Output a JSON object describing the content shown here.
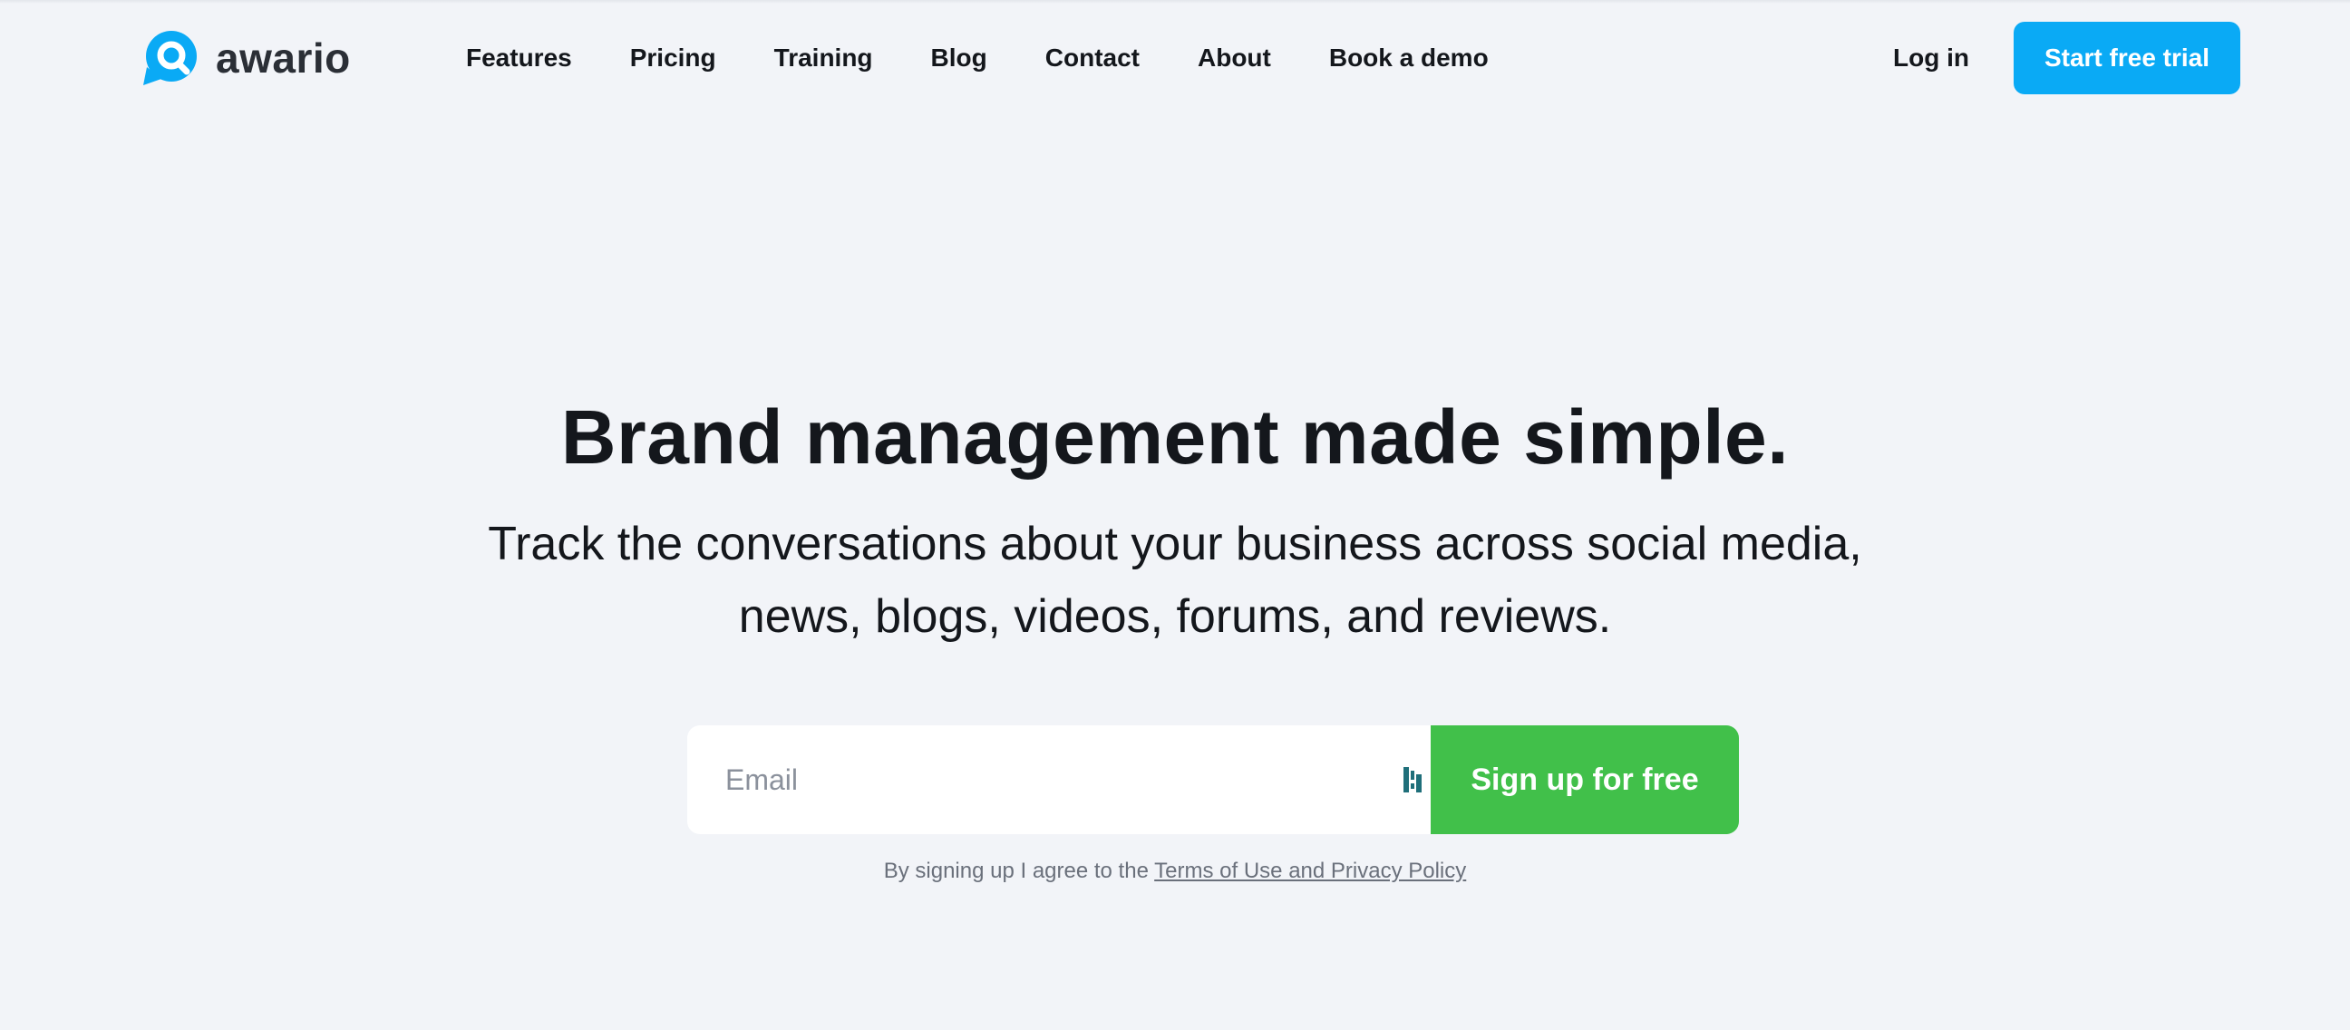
{
  "header": {
    "logo_text": "awario",
    "nav": [
      {
        "label": "Features"
      },
      {
        "label": "Pricing"
      },
      {
        "label": "Training"
      },
      {
        "label": "Blog"
      },
      {
        "label": "Contact"
      },
      {
        "label": "About"
      },
      {
        "label": "Book a demo"
      }
    ],
    "login_label": "Log in",
    "trial_label": "Start free trial"
  },
  "hero": {
    "title": "Brand management made simple.",
    "subtitle_line1": "Track the conversations about your business across social media,",
    "subtitle_line2": "news, blogs, videos, forums, and reviews."
  },
  "signup": {
    "email_placeholder": "Email",
    "email_value": "",
    "button_label": "Sign up for free",
    "terms_prefix": "By signing up I agree to the ",
    "terms_link": "Terms of Use and Privacy Policy"
  },
  "icons": {
    "logo": "speech-bubble-magnifier-icon",
    "password_manager": "password-manager-icon"
  },
  "colors": {
    "background": "#f2f4f8",
    "brand_blue": "#0aaaf5",
    "cta_green": "#41c04a",
    "text": "#14171c"
  }
}
